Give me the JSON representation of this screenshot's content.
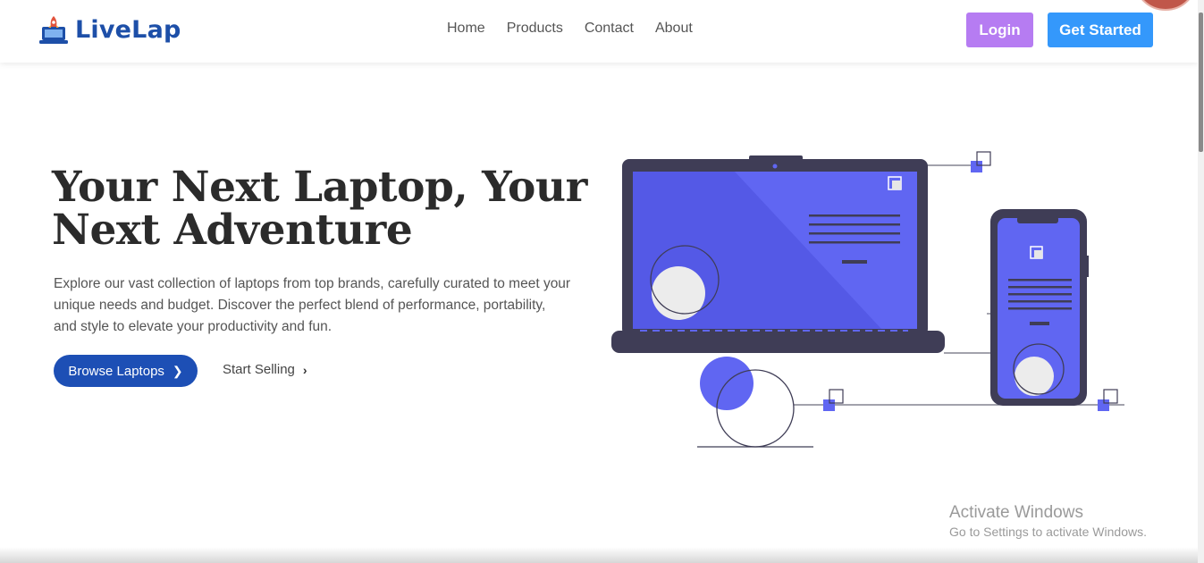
{
  "header": {
    "brand": "LiveLap",
    "nav": [
      "Home",
      "Products",
      "Contact",
      "About"
    ],
    "login_label": "Login",
    "get_started_label": "Get Started"
  },
  "hero": {
    "title": "Your Next Laptop, Your Next Adventure",
    "description": "Explore our vast collection of laptops from top brands, carefully curated to meet your unique needs and budget. Discover the perfect blend of performance, portability, and style to elevate your productivity and fun.",
    "browse_label": "Browse Laptops",
    "sell_label": "Start Selling"
  },
  "watermark": {
    "title": "Activate Windows",
    "subtitle": "Go to Settings to activate Windows."
  },
  "colors": {
    "brand": "#1d4fa8",
    "login": "#b67cf2",
    "get_started": "#3498fb",
    "browse": "#1d4fb5",
    "illustration_accent": "#6066f2",
    "device_frame": "#3f3d56"
  },
  "icons": {
    "brand_logo": "laptop-rocket-icon",
    "chevron": "chevron-right-icon"
  }
}
